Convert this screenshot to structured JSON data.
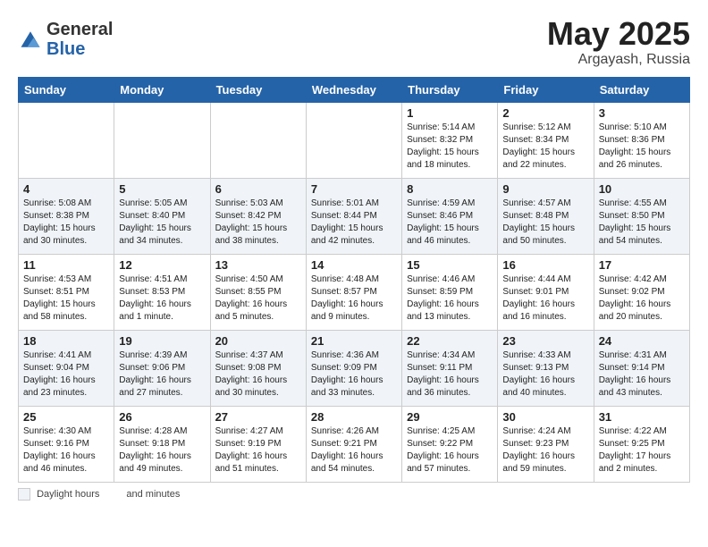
{
  "header": {
    "logo_general": "General",
    "logo_blue": "Blue",
    "month": "May 2025",
    "location": "Argayash, Russia"
  },
  "days_of_week": [
    "Sunday",
    "Monday",
    "Tuesday",
    "Wednesday",
    "Thursday",
    "Friday",
    "Saturday"
  ],
  "weeks": [
    [
      {
        "day": "",
        "info": ""
      },
      {
        "day": "",
        "info": ""
      },
      {
        "day": "",
        "info": ""
      },
      {
        "day": "",
        "info": ""
      },
      {
        "day": "1",
        "info": "Sunrise: 5:14 AM\nSunset: 8:32 PM\nDaylight: 15 hours\nand 18 minutes."
      },
      {
        "day": "2",
        "info": "Sunrise: 5:12 AM\nSunset: 8:34 PM\nDaylight: 15 hours\nand 22 minutes."
      },
      {
        "day": "3",
        "info": "Sunrise: 5:10 AM\nSunset: 8:36 PM\nDaylight: 15 hours\nand 26 minutes."
      }
    ],
    [
      {
        "day": "4",
        "info": "Sunrise: 5:08 AM\nSunset: 8:38 PM\nDaylight: 15 hours\nand 30 minutes."
      },
      {
        "day": "5",
        "info": "Sunrise: 5:05 AM\nSunset: 8:40 PM\nDaylight: 15 hours\nand 34 minutes."
      },
      {
        "day": "6",
        "info": "Sunrise: 5:03 AM\nSunset: 8:42 PM\nDaylight: 15 hours\nand 38 minutes."
      },
      {
        "day": "7",
        "info": "Sunrise: 5:01 AM\nSunset: 8:44 PM\nDaylight: 15 hours\nand 42 minutes."
      },
      {
        "day": "8",
        "info": "Sunrise: 4:59 AM\nSunset: 8:46 PM\nDaylight: 15 hours\nand 46 minutes."
      },
      {
        "day": "9",
        "info": "Sunrise: 4:57 AM\nSunset: 8:48 PM\nDaylight: 15 hours\nand 50 minutes."
      },
      {
        "day": "10",
        "info": "Sunrise: 4:55 AM\nSunset: 8:50 PM\nDaylight: 15 hours\nand 54 minutes."
      }
    ],
    [
      {
        "day": "11",
        "info": "Sunrise: 4:53 AM\nSunset: 8:51 PM\nDaylight: 15 hours\nand 58 minutes."
      },
      {
        "day": "12",
        "info": "Sunrise: 4:51 AM\nSunset: 8:53 PM\nDaylight: 16 hours\nand 1 minute."
      },
      {
        "day": "13",
        "info": "Sunrise: 4:50 AM\nSunset: 8:55 PM\nDaylight: 16 hours\nand 5 minutes."
      },
      {
        "day": "14",
        "info": "Sunrise: 4:48 AM\nSunset: 8:57 PM\nDaylight: 16 hours\nand 9 minutes."
      },
      {
        "day": "15",
        "info": "Sunrise: 4:46 AM\nSunset: 8:59 PM\nDaylight: 16 hours\nand 13 minutes."
      },
      {
        "day": "16",
        "info": "Sunrise: 4:44 AM\nSunset: 9:01 PM\nDaylight: 16 hours\nand 16 minutes."
      },
      {
        "day": "17",
        "info": "Sunrise: 4:42 AM\nSunset: 9:02 PM\nDaylight: 16 hours\nand 20 minutes."
      }
    ],
    [
      {
        "day": "18",
        "info": "Sunrise: 4:41 AM\nSunset: 9:04 PM\nDaylight: 16 hours\nand 23 minutes."
      },
      {
        "day": "19",
        "info": "Sunrise: 4:39 AM\nSunset: 9:06 PM\nDaylight: 16 hours\nand 27 minutes."
      },
      {
        "day": "20",
        "info": "Sunrise: 4:37 AM\nSunset: 9:08 PM\nDaylight: 16 hours\nand 30 minutes."
      },
      {
        "day": "21",
        "info": "Sunrise: 4:36 AM\nSunset: 9:09 PM\nDaylight: 16 hours\nand 33 minutes."
      },
      {
        "day": "22",
        "info": "Sunrise: 4:34 AM\nSunset: 9:11 PM\nDaylight: 16 hours\nand 36 minutes."
      },
      {
        "day": "23",
        "info": "Sunrise: 4:33 AM\nSunset: 9:13 PM\nDaylight: 16 hours\nand 40 minutes."
      },
      {
        "day": "24",
        "info": "Sunrise: 4:31 AM\nSunset: 9:14 PM\nDaylight: 16 hours\nand 43 minutes."
      }
    ],
    [
      {
        "day": "25",
        "info": "Sunrise: 4:30 AM\nSunset: 9:16 PM\nDaylight: 16 hours\nand 46 minutes."
      },
      {
        "day": "26",
        "info": "Sunrise: 4:28 AM\nSunset: 9:18 PM\nDaylight: 16 hours\nand 49 minutes."
      },
      {
        "day": "27",
        "info": "Sunrise: 4:27 AM\nSunset: 9:19 PM\nDaylight: 16 hours\nand 51 minutes."
      },
      {
        "day": "28",
        "info": "Sunrise: 4:26 AM\nSunset: 9:21 PM\nDaylight: 16 hours\nand 54 minutes."
      },
      {
        "day": "29",
        "info": "Sunrise: 4:25 AM\nSunset: 9:22 PM\nDaylight: 16 hours\nand 57 minutes."
      },
      {
        "day": "30",
        "info": "Sunrise: 4:24 AM\nSunset: 9:23 PM\nDaylight: 16 hours\nand 59 minutes."
      },
      {
        "day": "31",
        "info": "Sunrise: 4:22 AM\nSunset: 9:25 PM\nDaylight: 17 hours\nand 2 minutes."
      }
    ]
  ],
  "legend": {
    "daylight_label": "Daylight hours",
    "and_minutes": "and minutes"
  }
}
